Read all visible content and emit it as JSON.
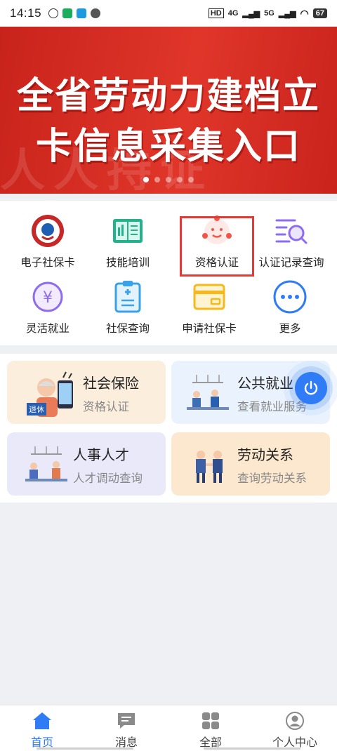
{
  "status_bar": {
    "time": "14:15",
    "network": [
      "4G",
      "5G"
    ],
    "battery": "67"
  },
  "banner": {
    "line1": "全省劳动力建档立",
    "line2": "卡信息采集入口",
    "watermark": "人人持证",
    "dot_count": 5,
    "active_dot": 0
  },
  "services": [
    {
      "label": "电子社保卡",
      "icon": "social-security-card-icon"
    },
    {
      "label": "技能培训",
      "icon": "open-book-icon"
    },
    {
      "label": "资格认证",
      "icon": "face-recognition-icon"
    },
    {
      "label": "认证记录查询",
      "icon": "list-search-icon"
    },
    {
      "label": "灵活就业",
      "icon": "yuan-coin-icon"
    },
    {
      "label": "社保查询",
      "icon": "clipboard-icon"
    },
    {
      "label": "申请社保卡",
      "icon": "card-icon"
    },
    {
      "label": "更多",
      "icon": "more-dots-icon"
    }
  ],
  "cards": [
    {
      "title": "社会保险",
      "sub": "资格认证",
      "badge": "退休",
      "bg": "#fbeedd"
    },
    {
      "title": "公共就业",
      "sub": "查看就业服务",
      "bg": "#eaf3fd"
    },
    {
      "title": "人事人才",
      "sub": "人才调动查询",
      "bg": "#e9e9fa"
    },
    {
      "title": "劳动关系",
      "sub": "查询劳动关系",
      "bg": "#fce8cf"
    }
  ],
  "nav": [
    {
      "label": "首页",
      "icon": "home-icon",
      "active": true
    },
    {
      "label": "消息",
      "icon": "message-icon"
    },
    {
      "label": "全部",
      "icon": "grid-icon"
    },
    {
      "label": "个人中心",
      "icon": "person-icon"
    }
  ],
  "colors": {
    "accent": "#2f7cf6",
    "banner": "#d92d22",
    "highlight": "#e53935"
  }
}
